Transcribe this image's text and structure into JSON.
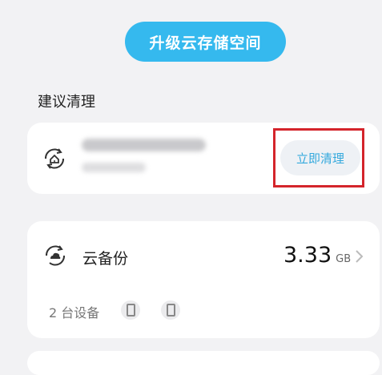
{
  "upgrade_button": {
    "label": "升级云存储空间",
    "color": "#35b9ee"
  },
  "suggestions": {
    "title": "建议清理",
    "item": {
      "icon": "cleanup-home-icon",
      "action_label": "立即清理"
    }
  },
  "backup": {
    "icon": "cloud-backup-icon",
    "label": "云备份",
    "value": "3.33",
    "unit": "GB",
    "devices_label": "2 台设备",
    "device_icons": [
      "phone-icon",
      "phone-icon"
    ]
  },
  "colors": {
    "accent": "#34a9dd",
    "highlight": "#d4242b"
  }
}
